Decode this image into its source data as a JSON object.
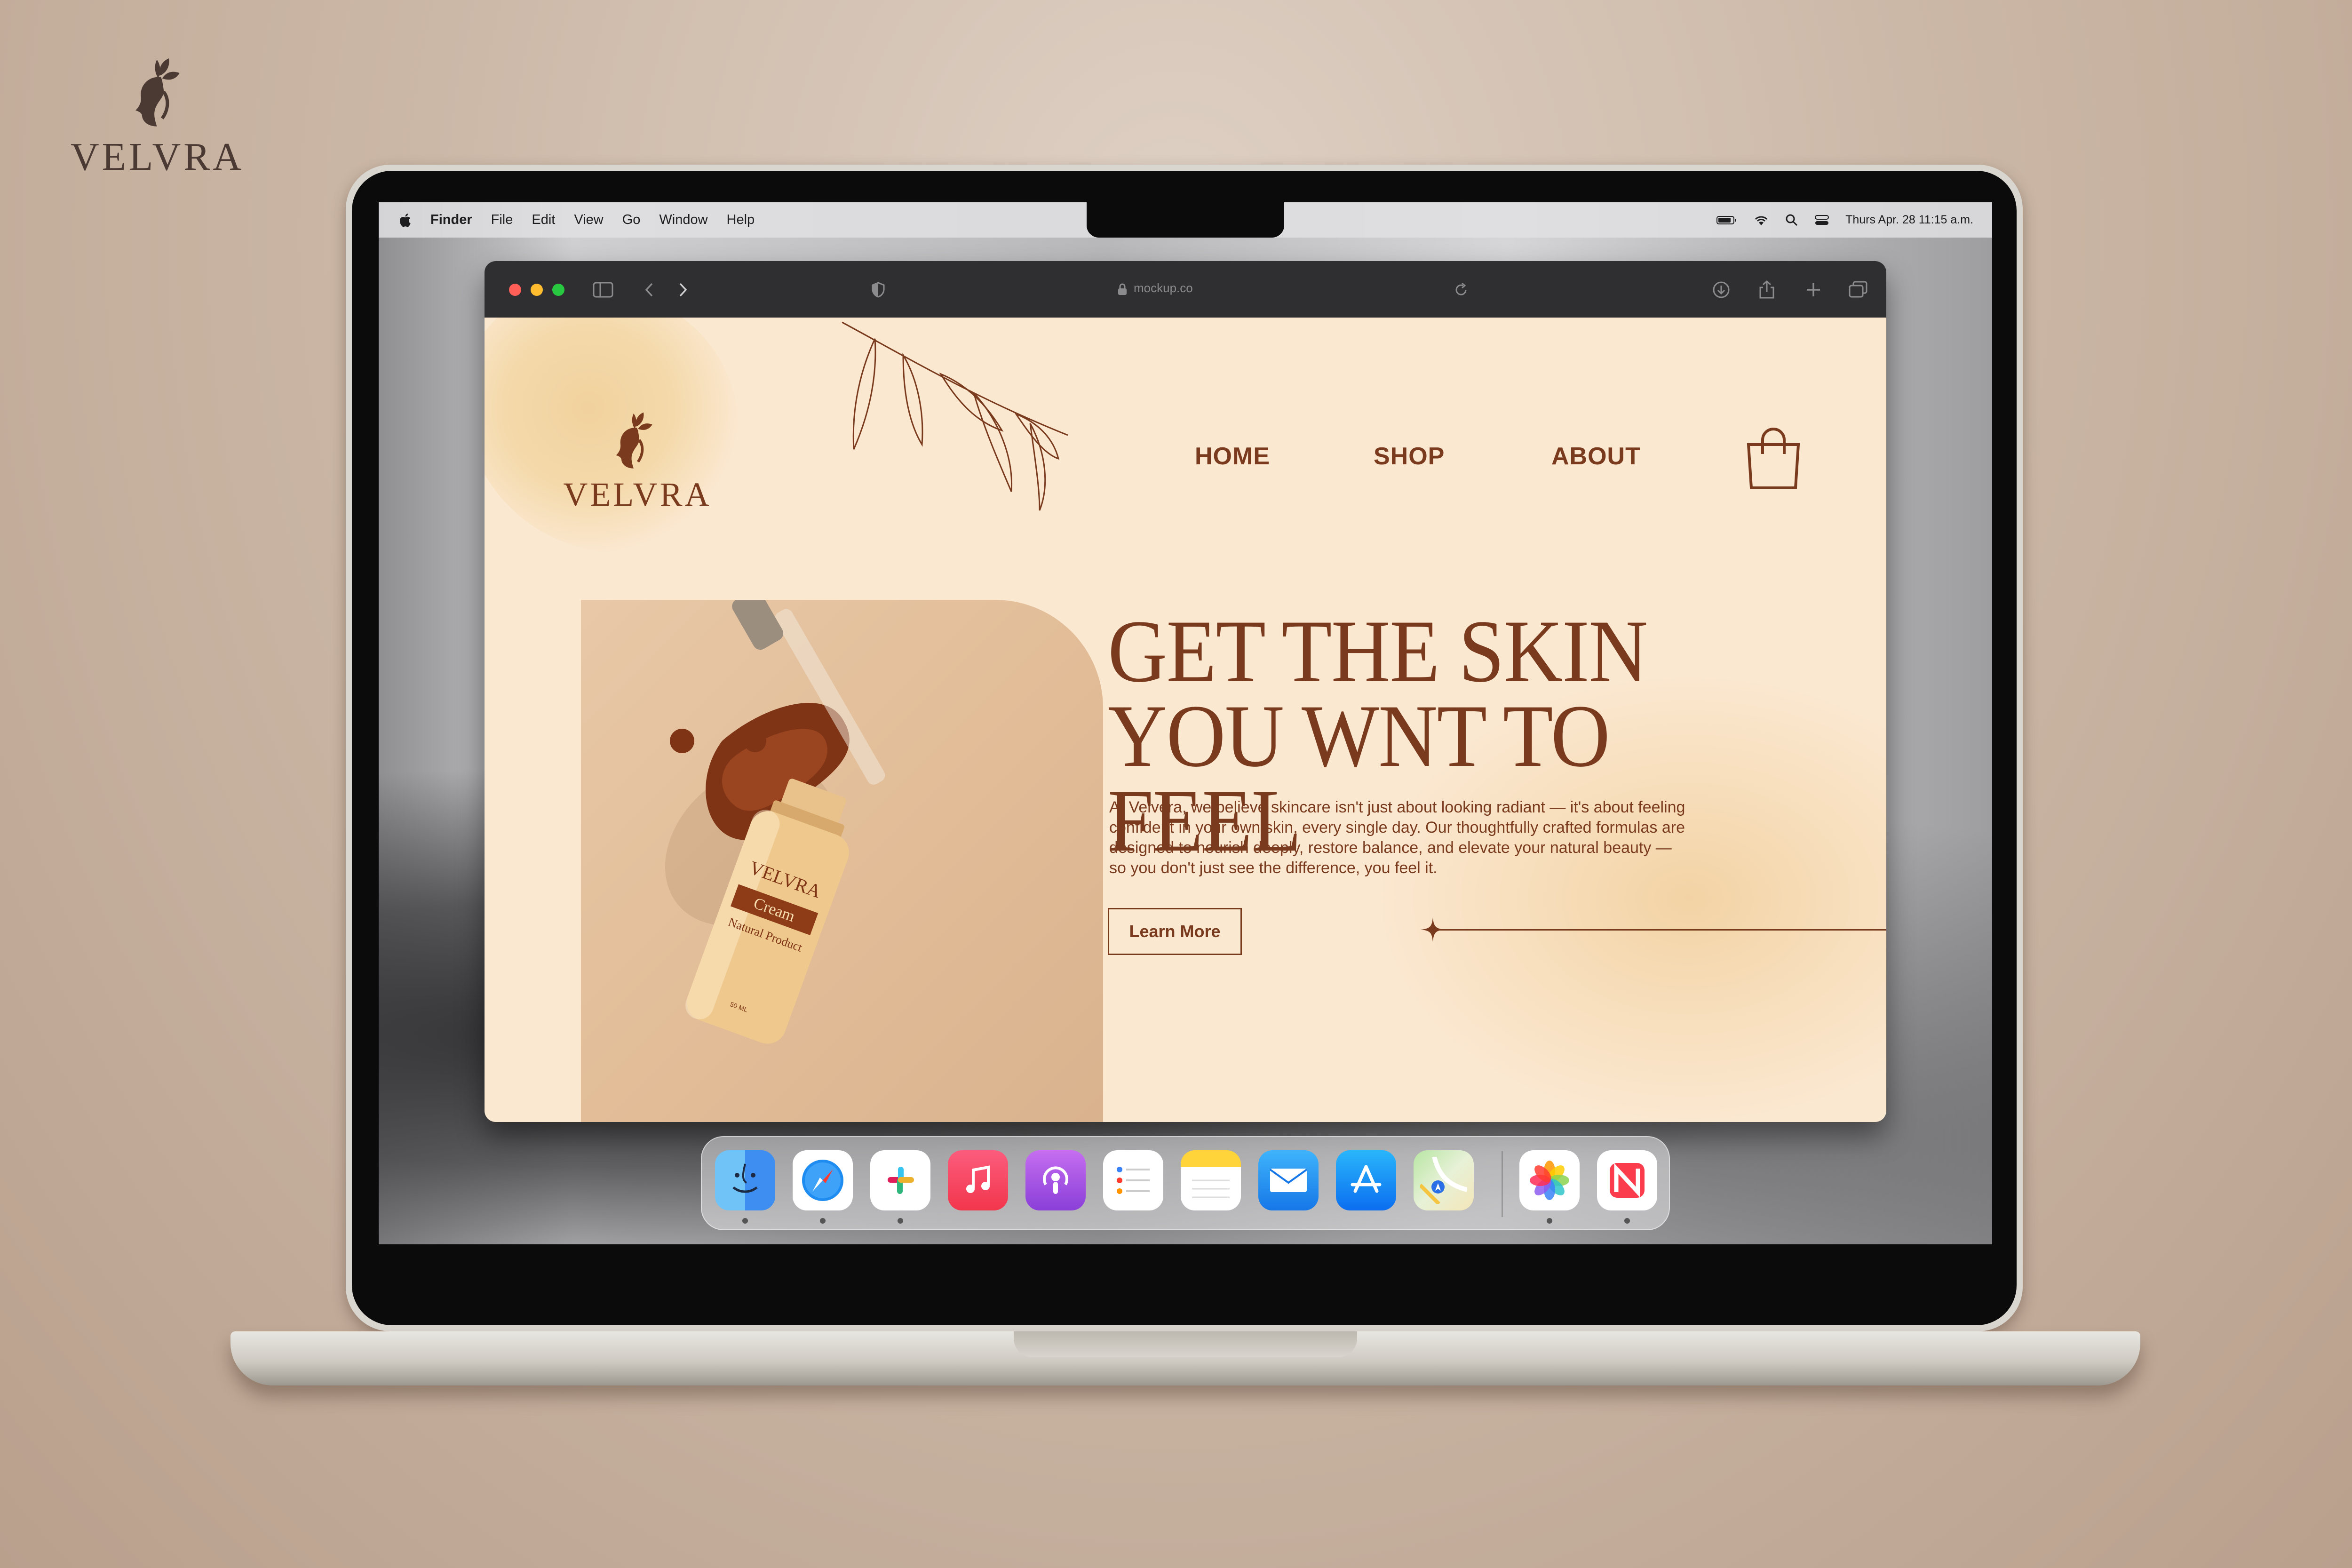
{
  "corner_brand": {
    "wordmark": "VELVRA"
  },
  "menubar": {
    "app_name": "Finder",
    "items": [
      "File",
      "Edit",
      "View",
      "Go",
      "Window",
      "Help"
    ],
    "clock": "Thurs Apr. 28 11:15 a.m.",
    "icons": [
      "battery-icon",
      "wifi-icon",
      "search-icon",
      "control-center-icon"
    ]
  },
  "browser": {
    "url": "mockup.co",
    "toolbar_icons": [
      "sidebar-icon",
      "back-icon",
      "forward-icon",
      "shield-icon",
      "lock-icon",
      "reload-icon",
      "download-icon",
      "share-icon",
      "new-tab-icon",
      "tabs-icon"
    ]
  },
  "site": {
    "logo_wordmark": "VELVRA",
    "nav": {
      "home": "HOME",
      "shop": "SHOP",
      "about": "ABOUT"
    },
    "hero": {
      "headline_line1": "GET THE SKIN",
      "headline_line2": "YOU WNT TO FEEL",
      "paragraph": "At Velvera, we believe skincare isn't just about looking radiant — it's about feeling confident in your own skin, every single day. Our thoughtfully crafted formulas are designed to nourish deeply, restore balance, and elevate your natural beauty — so you don't just see the difference, you feel it.",
      "cta": "Learn More"
    },
    "product": {
      "brand": "VELVRA",
      "name": "Cream",
      "subtitle": "Natural Product",
      "size": "50 ML"
    }
  },
  "dock": {
    "apps": [
      "finder",
      "safari",
      "slack",
      "music",
      "podcasts",
      "reminders",
      "notes",
      "mail",
      "app-store",
      "maps",
      "photos",
      "news"
    ]
  },
  "colors": {
    "brand_brown": "#7a3a1d",
    "page_cream": "#fbe8d1",
    "backdrop": "#ccb8a7"
  }
}
